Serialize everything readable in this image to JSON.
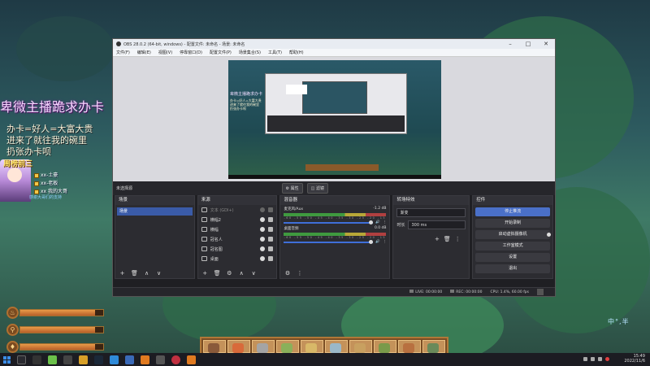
{
  "stream_overlay": {
    "title": "卑微主播跪求办卡",
    "lines": [
      "办卡=好人=大富大贵",
      "进来了就往我的碗里",
      "扔张办卡呗"
    ],
    "rank_title": "周榜前三",
    "rank_items": [
      "xx-土豪",
      "xx-老板",
      "xx 我的大哥"
    ],
    "rank_note": "感谢大哥们的支持"
  },
  "game_hud": {
    "bars": [
      {
        "icon": "flame-icon",
        "glyph": "♨",
        "fill": 0.9
      },
      {
        "icon": "drumstick-icon",
        "glyph": "⚲",
        "fill": 0.9
      },
      {
        "icon": "drop-icon",
        "glyph": "♦",
        "fill": 0.9
      }
    ],
    "hotbar_slots": 10,
    "ime_text": "中°,半"
  },
  "obs": {
    "window_title": "OBS 28.0.2 (64-bit, windows) - 配置文件: 未命名 - 场景: 未命名",
    "window_controls": [
      "–",
      "□",
      "✕"
    ],
    "menu": [
      "文件(F)",
      "编辑(E)",
      "视图(V)",
      "停靠窗口(D)",
      "配置文件(P)",
      "场景集合(S)",
      "工具(T)",
      "帮助(H)"
    ],
    "preview_overlay_title": "卑微主播跪求办卡",
    "preview_overlay_lines": [
      "办卡=好人=大富大贵",
      "进来了就往我的碗里",
      "扔张办卡呗"
    ],
    "scene_bar": {
      "label": "未选择源",
      "properties": "属性",
      "filters": "滤镜"
    },
    "scenes": {
      "title": "场景",
      "items": [
        "场景"
      ],
      "footer": [
        "+",
        "🗑",
        "∧",
        "∨"
      ]
    },
    "sources": {
      "title": "来源",
      "items": [
        {
          "name": "文本 (GDI+)",
          "dim": true
        },
        {
          "name": "横幅2",
          "dim": false
        },
        {
          "name": "横幅",
          "dim": false
        },
        {
          "name": "冠名人",
          "dim": false
        },
        {
          "name": "冠名图",
          "dim": false
        },
        {
          "name": "桌面",
          "dim": false
        }
      ],
      "footer": [
        "+",
        "🗑",
        "⚙",
        "∧",
        "∨"
      ]
    },
    "mixer": {
      "title": "混音器",
      "channels": [
        {
          "name": "麦克风/Aux",
          "db": "-1.2 dB"
        },
        {
          "name": "桌面音频",
          "db": "0.0 dB"
        }
      ],
      "ticks": "-60 -55 -50 -45 -40 -35 -30 -25 -20 -15 -10 -5 0",
      "footer": [
        "⚙",
        "⋮"
      ]
    },
    "transitions": {
      "title": "转场特效",
      "type": "渐变",
      "duration_label": "时长",
      "duration": "300 ms",
      "footer": [
        "+",
        "🗑",
        "⋮"
      ]
    },
    "controls": {
      "title": "控件",
      "buttons": [
        "停止推流",
        "开始录制",
        "启动虚拟摄像机",
        "工作室模式",
        "设置",
        "退出"
      ]
    },
    "status": {
      "live": "LIVE: 00:00:00",
      "rec": "REC: 00:00:00",
      "cpu": "CPU: 1.4%, 60.00 fps"
    }
  },
  "taskbar": {
    "time": "15:49",
    "date": "2022/11/6"
  }
}
